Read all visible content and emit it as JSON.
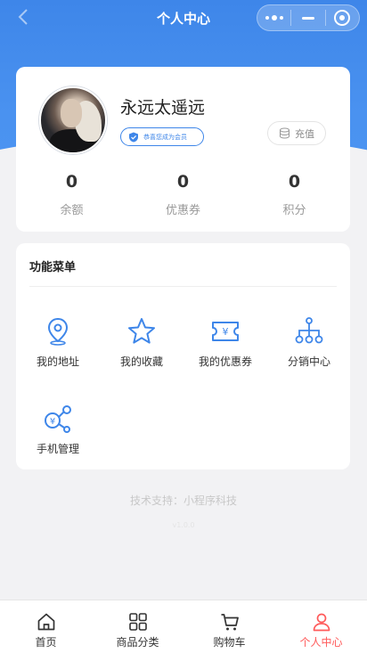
{
  "navbar": {
    "title": "个人中心",
    "back_icon": "chevron-left-icon",
    "capsule_icons": [
      "more-dots-icon",
      "minimize-icon",
      "close-target-icon"
    ]
  },
  "user": {
    "name": "永远太遥远",
    "member_badge": "恭喜您成为会员",
    "recharge_label": "充值"
  },
  "stats": [
    {
      "value": "0",
      "label": "余额"
    },
    {
      "value": "0",
      "label": "优惠券"
    },
    {
      "value": "0",
      "label": "积分"
    }
  ],
  "menu": {
    "title": "功能菜单",
    "items": [
      {
        "label": "我的地址",
        "icon": "location-pin-icon"
      },
      {
        "label": "我的收藏",
        "icon": "star-icon"
      },
      {
        "label": "我的优惠券",
        "icon": "coupon-ticket-icon"
      },
      {
        "label": "分销中心",
        "icon": "org-tree-icon"
      },
      {
        "label": "手机管理",
        "icon": "money-link-icon"
      }
    ]
  },
  "footer": {
    "support": "技术支持：小程序科技",
    "version": "v1.0.0"
  },
  "tabbar": [
    {
      "label": "首页",
      "icon": "home-icon",
      "active": false
    },
    {
      "label": "商品分类",
      "icon": "grid-category-icon",
      "active": false
    },
    {
      "label": "购物车",
      "icon": "cart-icon",
      "active": false
    },
    {
      "label": "个人中心",
      "icon": "person-icon",
      "active": true
    }
  ],
  "colors": {
    "primary": "#3e86e9",
    "active_tab": "#ff5a5a",
    "background": "#f2f2f4"
  }
}
